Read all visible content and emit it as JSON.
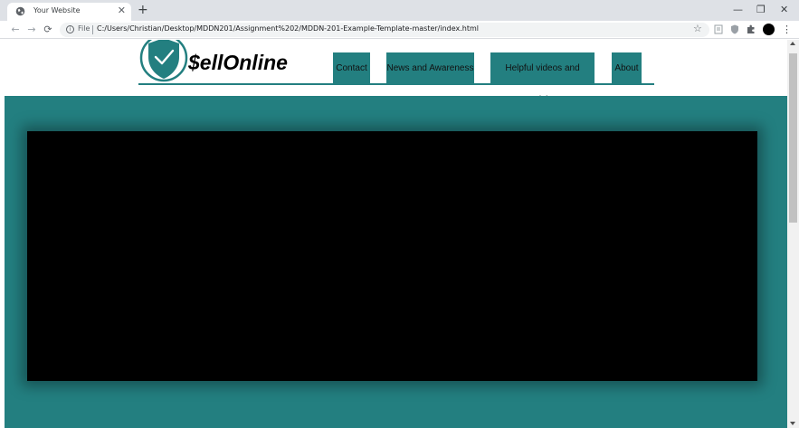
{
  "browser": {
    "tab_title": "Your Website",
    "tab_close": "✕",
    "new_tab": "+",
    "scheme_label": "File",
    "url": "C:/Users/Christian/Desktop/MDDN201/Assignment%202/MDDN-201-Example-Template-master/index.html",
    "window_controls": {
      "minimize": "—",
      "restore": "❐",
      "close": "✕"
    },
    "icons": [
      "globe-icon",
      "back-arrow-icon",
      "forward-arrow-icon",
      "reload-icon",
      "info-icon",
      "star-icon",
      "reader-mode-icon",
      "shield-extension-icon",
      "puzzle-extension-icon",
      "profile-avatar-icon",
      "kebab-menu-icon"
    ]
  },
  "site": {
    "logo_text": "$ellOnline",
    "nav": [
      {
        "label": "Contact"
      },
      {
        "label": "News and Awareness"
      },
      {
        "label": "Helpful videos and Articles"
      },
      {
        "label": "About"
      }
    ]
  },
  "colors": {
    "brand_teal": "#237f80",
    "video_background": "#000000",
    "chrome_tabbar": "#dee1e6",
    "omnibox": "#f1f3f4"
  }
}
